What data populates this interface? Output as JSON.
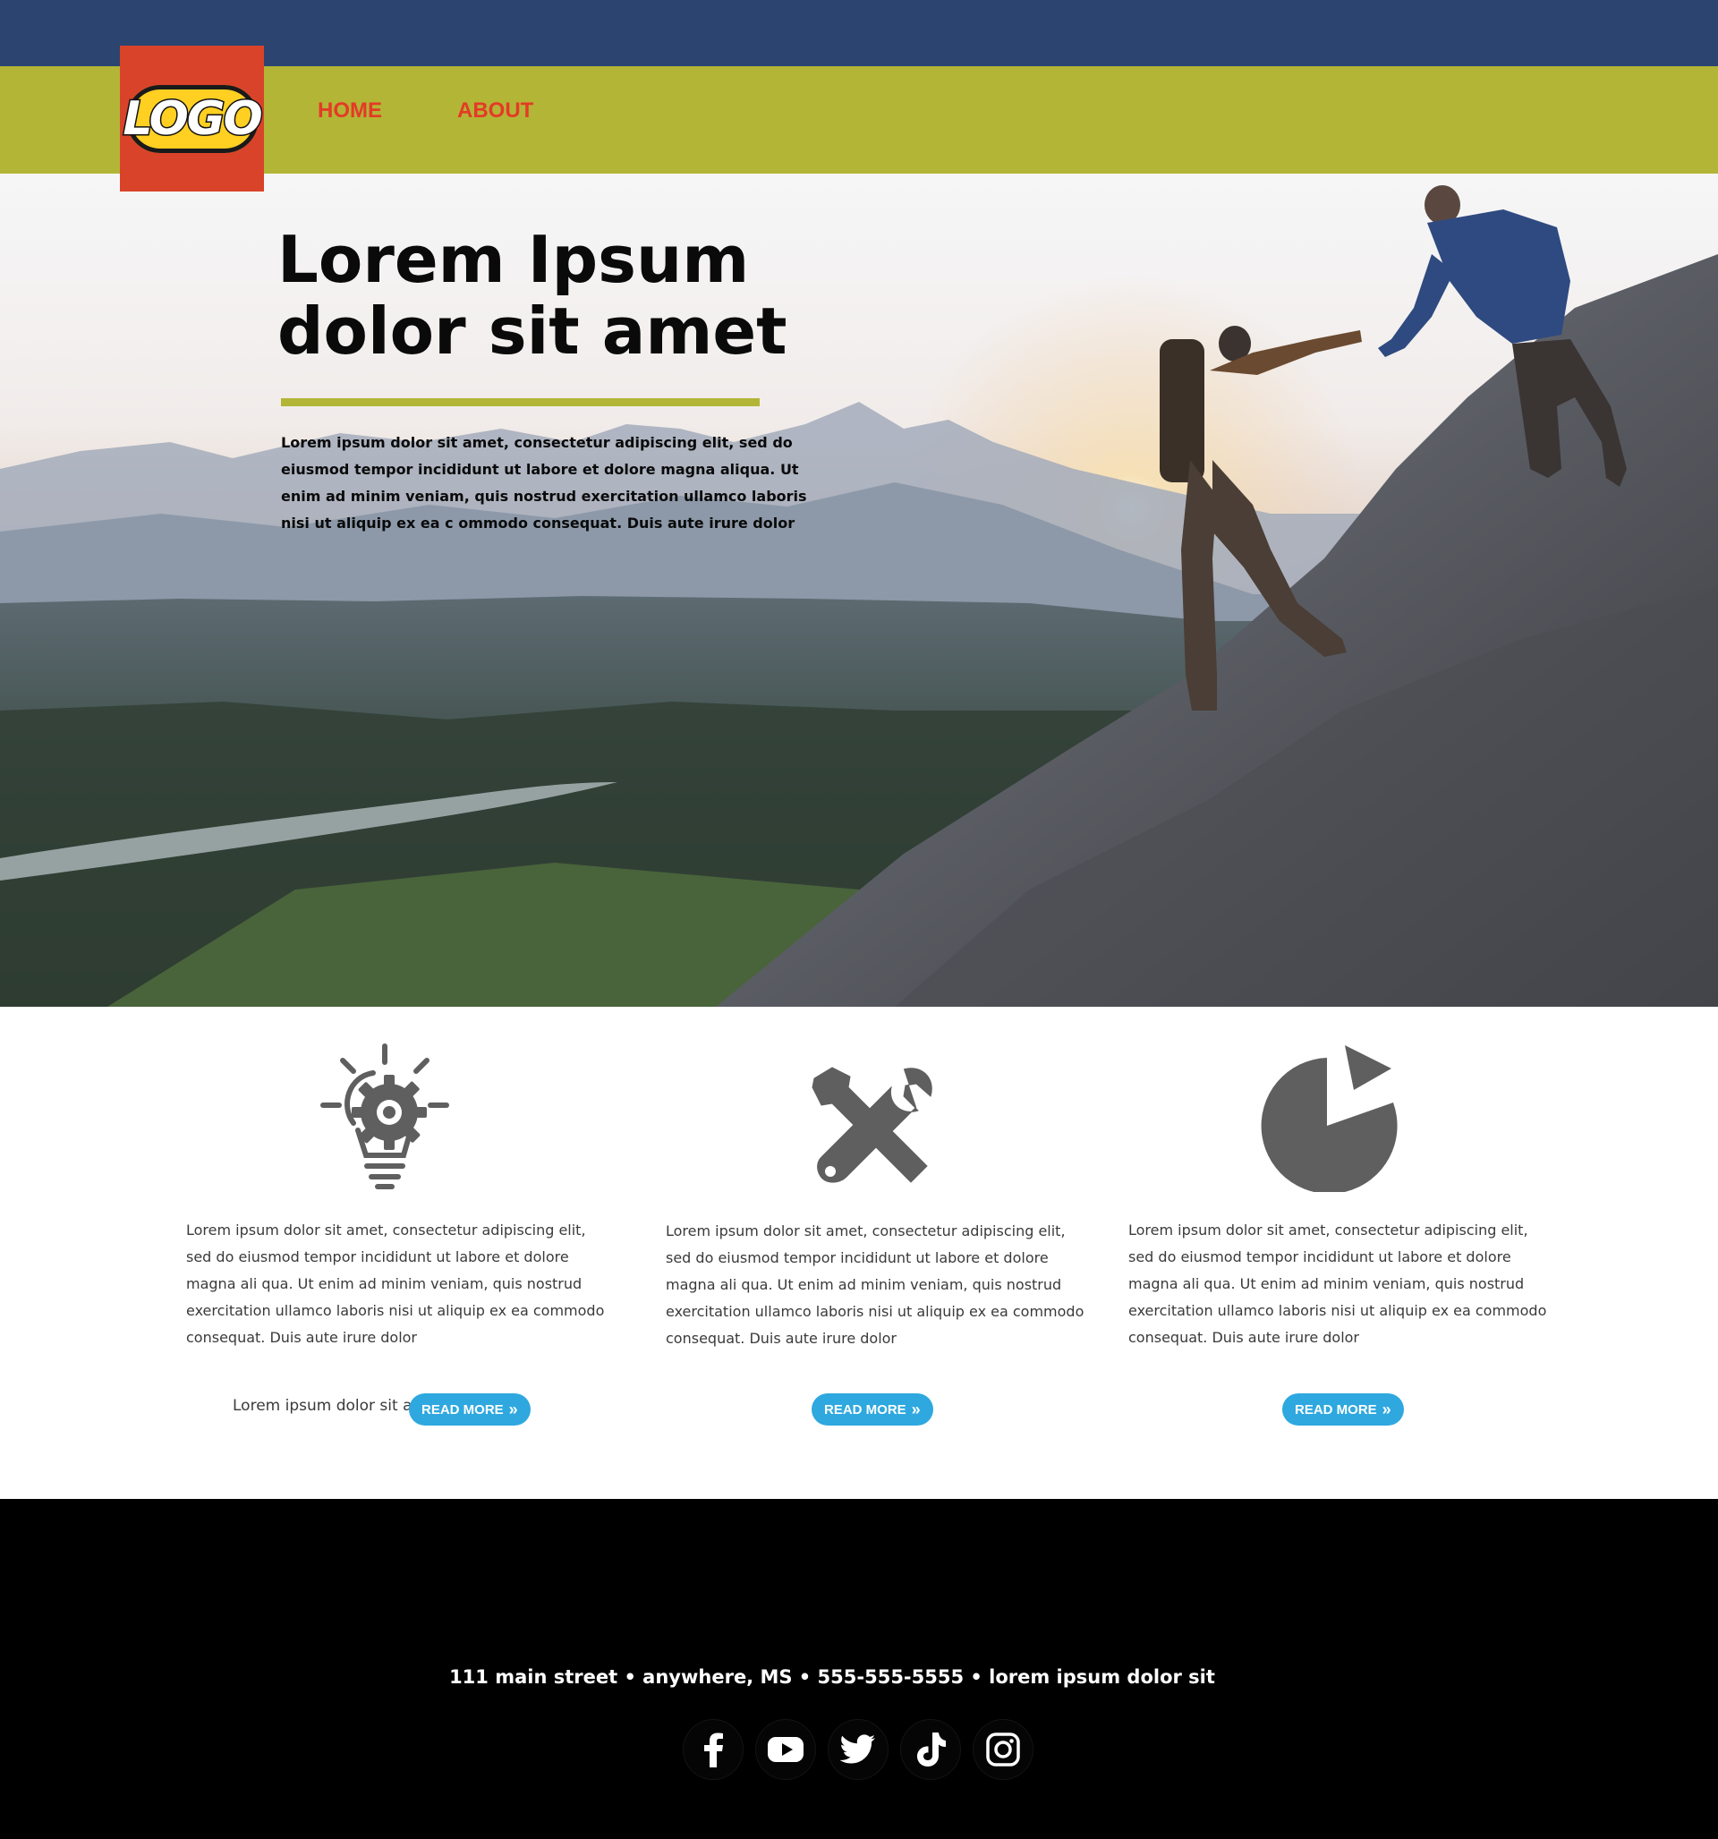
{
  "nav": {
    "logo_text": "LOGO",
    "items": [
      {
        "label": "HOME"
      },
      {
        "label": "ABOUT"
      }
    ]
  },
  "hero": {
    "title": "Lorem Ipsum\ndolor sit amet",
    "text": "Lorem ipsum dolor sit amet, consectetur adipiscing elit, sed do eiusmod tempor incididunt ut labore et dolore magna aliqua. Ut enim ad minim veniam, quis nostrud exercitation ullamco laboris nisi ut aliquip ex ea c ommodo consequat. Duis aute irure dolor"
  },
  "features": [
    {
      "icon": "lightbulb-gear-icon",
      "text": "Lorem ipsum dolor sit amet, consectetur adipiscing elit, sed do eiusmod tempor incididunt ut labore et dolore magna ali qua. Ut enim ad minim veniam, quis nostrud exercitation ullamco laboris nisi ut aliquip ex ea commodo consequat. Duis aute irure dolor",
      "button": "READ MORE",
      "side_text": "Lorem ipsum dolor sit a"
    },
    {
      "icon": "wrench-screwdriver-icon",
      "text": "Lorem ipsum dolor sit amet, consectetur adipiscing elit, sed do eiusmod tempor incididunt ut labore et dolore magna ali qua. Ut enim ad minim veniam, quis nostrud exercitation ullamco laboris nisi ut aliquip ex ea commodo consequat. Duis aute irure dolor",
      "button": "READ MORE"
    },
    {
      "icon": "pie-chart-icon",
      "text": "Lorem ipsum dolor sit amet, consectetur adipiscing elit, sed do eiusmod tempor incididunt ut labore et dolore magna ali qua. Ut enim ad minim veniam, quis nostrud exercitation ullamco laboris nisi ut aliquip ex ea commodo consequat. Duis aute irure dolor",
      "button": "READ MORE"
    }
  ],
  "footer": {
    "address": "111 main street  •   anywhere, MS  •  555-555-5555  •  lorem ipsum dolor sit",
    "social": [
      "facebook-icon",
      "youtube-icon",
      "twitter-icon",
      "tiktok-icon",
      "instagram-icon"
    ]
  },
  "colors": {
    "topbar": "#2b4570",
    "navbar": "#b3b536",
    "nav_link": "#e43a27",
    "logo_bg": "#d9432a",
    "accent_rule": "#b3b536",
    "button": "#2ea8df",
    "icon_gray": "#5f5f5f",
    "footer": "#000000"
  }
}
